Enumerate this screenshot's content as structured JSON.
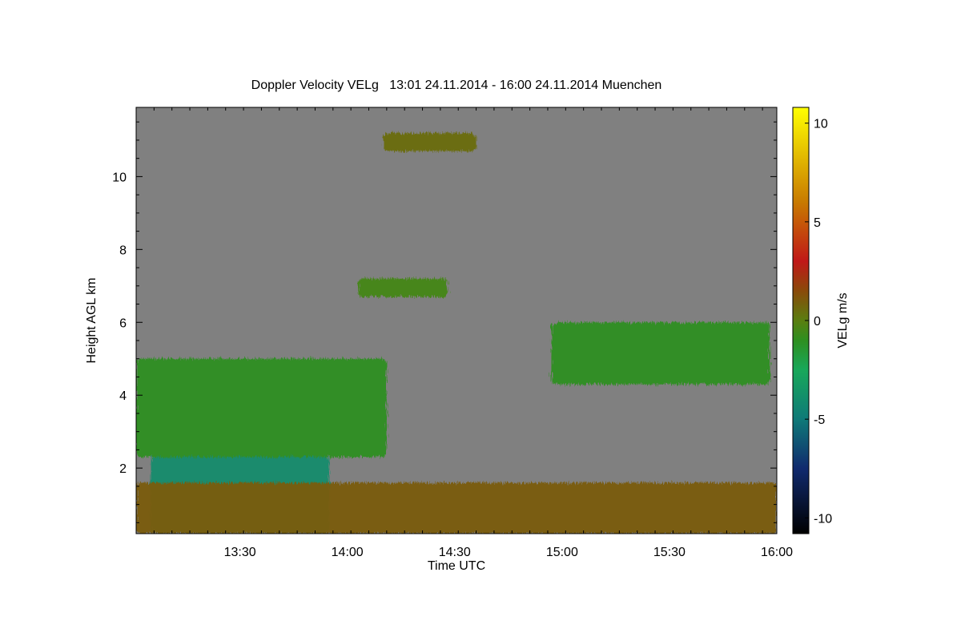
{
  "chart_data": {
    "type": "heatmap",
    "title": "Doppler Velocity VELg   13:01 24.11.2014 - 16:00 24.11.2014 Muenchen",
    "xlabel": "Time UTC",
    "ylabel": "Height AGL km",
    "colorbar_label": "VELg m/s",
    "x_range": [
      "13:01",
      "16:00"
    ],
    "xticks": [
      "13:30",
      "14:00",
      "14:30",
      "15:00",
      "15:30",
      "16:00"
    ],
    "ylim": [
      0.2,
      11.9
    ],
    "yticks": [
      2,
      4,
      6,
      8,
      10
    ],
    "colorbar_range": [
      -10.8,
      10.8
    ],
    "colorbar_ticks": [
      10,
      5,
      0,
      -5,
      -10
    ],
    "background_color": "#808080",
    "colormap": [
      {
        "v": -10.8,
        "color": "#000000"
      },
      {
        "v": -7.5,
        "color": "#102a6e"
      },
      {
        "v": -5,
        "color": "#0f7a78"
      },
      {
        "v": -2.5,
        "color": "#18a85a"
      },
      {
        "v": -1,
        "color": "#2e8f20"
      },
      {
        "v": 0,
        "color": "#5a7e10"
      },
      {
        "v": 1.5,
        "color": "#8a4a0a"
      },
      {
        "v": 3,
        "color": "#c01818"
      },
      {
        "v": 6,
        "color": "#c87a00"
      },
      {
        "v": 10.8,
        "color": "#ffff00"
      }
    ],
    "features": [
      {
        "name": "precipitating cloud",
        "time": [
          "13:01",
          "14:11"
        ],
        "height_km": [
          2.3,
          5.0
        ],
        "velocity_ms": -1
      },
      {
        "name": "precipitation shafts",
        "time": [
          "13:05",
          "13:55"
        ],
        "height_km": [
          0.2,
          2.3
        ],
        "velocity_ms": -4
      },
      {
        "name": "cloud 5 km",
        "time": [
          "14:57",
          "15:58"
        ],
        "height_km": [
          4.3,
          6.0
        ],
        "velocity_ms": -1
      },
      {
        "name": "cloud 7 km",
        "time": [
          "14:03",
          "14:28"
        ],
        "height_km": [
          6.7,
          7.2
        ],
        "velocity_ms": -0.5
      },
      {
        "name": "cirrus 11 km",
        "time": [
          "14:10",
          "14:36"
        ],
        "height_km": [
          10.7,
          11.2
        ],
        "velocity_ms": 0.5
      },
      {
        "name": "boundary layer",
        "time": [
          "13:01",
          "16:00"
        ],
        "height_km": [
          0.2,
          1.6
        ],
        "velocity_ms": 1
      }
    ]
  }
}
